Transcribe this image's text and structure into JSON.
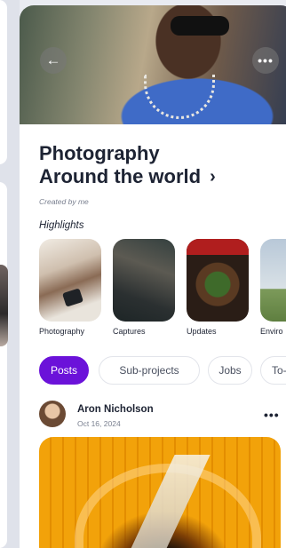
{
  "hero": {
    "back_icon": "←",
    "more_icon": "•••"
  },
  "project": {
    "title_line1": "Photography",
    "title_line2": "Around the world",
    "title_chevron": "›",
    "created_by": "Created by me"
  },
  "highlights": {
    "label": "Highlights",
    "items": [
      {
        "caption": "Photography"
      },
      {
        "caption": "Captures"
      },
      {
        "caption": "Updates"
      },
      {
        "caption": "Enviro"
      }
    ]
  },
  "tabs": [
    {
      "label": "Posts",
      "active": true
    },
    {
      "label": "Sub-projects",
      "active": false
    },
    {
      "label": "Jobs",
      "active": false
    },
    {
      "label": "To-dos",
      "active": false
    }
  ],
  "post": {
    "author": "Aron Nicholson",
    "date": "Oct 16, 2024",
    "more_icon": "•••"
  },
  "colors": {
    "accent": "#6b12d9",
    "text": "#1d2333",
    "muted": "#7a8090"
  }
}
